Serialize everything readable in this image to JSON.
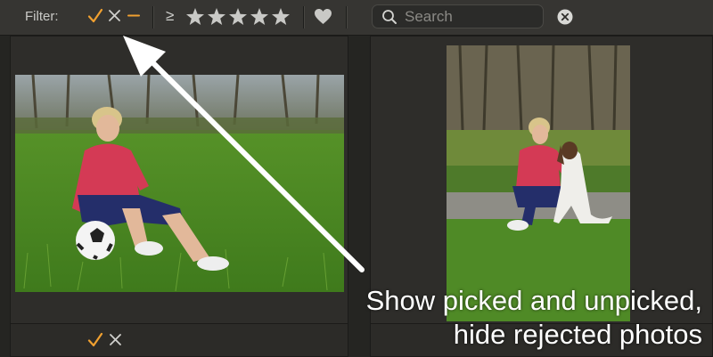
{
  "toolbar": {
    "filter_label": "Filter:",
    "flag_icons": [
      "check-icon",
      "x-icon",
      "dash-icon"
    ],
    "rating_prefix": "≥",
    "star_count": 5,
    "search": {
      "placeholder": "Search",
      "value": ""
    }
  },
  "panels": [
    {
      "photo": "woman-sitting-on-grass-with-soccer-ball",
      "footer_flags": [
        "check-icon",
        "x-icon"
      ]
    },
    {
      "photo": "woman-crouching-with-dog-on-path",
      "footer_flags": []
    }
  ],
  "caption": {
    "line1": "Show picked and unpicked,",
    "line2": "hide rejected photos"
  },
  "colors": {
    "toolbar_bg": "#363532",
    "panel_bg": "#2e2d2a",
    "accent_orange": "#f0a030",
    "icon_gray": "#cfcfcc",
    "caption_text": "#ffffff"
  }
}
